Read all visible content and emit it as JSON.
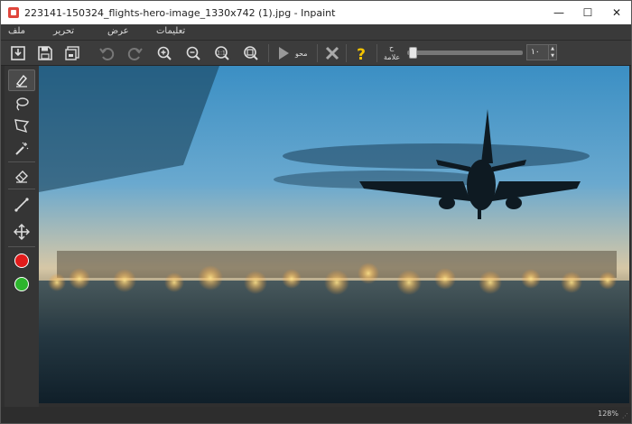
{
  "window": {
    "title": "223141-150324_flights-hero-image_1330x742 (1).jpg - Inpaint",
    "minimize": "—",
    "maximize": "☐",
    "close": "✕"
  },
  "menu": {
    "file": "ملف",
    "edit": "تحرير",
    "view": "عرض",
    "help": "تعليمات"
  },
  "toolbar": {
    "erase_label": "محو",
    "marker_label": "علامة",
    "marker_prefix": "ح",
    "spin_value": "١٠",
    "spin_up": "▲",
    "spin_down": "▼"
  },
  "status": {
    "zoom": "128%",
    "grip": "⋰"
  },
  "colors": {
    "accent_red": "#e21b1b",
    "accent_green": "#2db52d",
    "help_yellow": "#f5c400"
  },
  "icons": {
    "open": "open-file-icon",
    "save": "save-icon",
    "save_as": "save-as-icon",
    "undo": "undo-icon",
    "redo": "redo-icon",
    "zoom_in": "zoom-in-icon",
    "zoom_out": "zoom-out-icon",
    "zoom_actual": "zoom-1to1-icon",
    "zoom_fit": "zoom-fit-icon",
    "erase": "play-icon",
    "cancel": "x-icon",
    "help": "question-icon"
  }
}
